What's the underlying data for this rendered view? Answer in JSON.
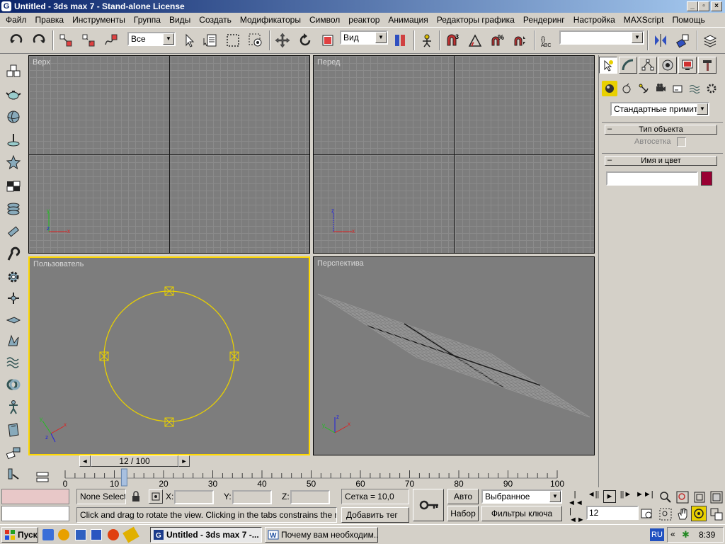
{
  "titlebar": {
    "title": "Untitled - 3ds max 7 - Stand-alone License",
    "icon": "G"
  },
  "menu": [
    "Файл",
    "Правка",
    "Инструменты",
    "Группа",
    "Виды",
    "Создать",
    "Модификаторы",
    "Символ",
    "реактор",
    "Анимация",
    "Редакторы графика",
    "Рендеринг",
    "Настройка",
    "MAXScript",
    "Помощь"
  ],
  "toolbar": {
    "selection_filter": "Все",
    "reference_coord": "Вид",
    "named_selection": ""
  },
  "viewports": {
    "top": "Верх",
    "front": "Перед",
    "user": "Пользователь",
    "perspective": "Перспектива"
  },
  "panel": {
    "category_dropdown": "Стандартные примитив",
    "rollout_object_type": "Тип объекта",
    "autogrid_label": "Автосетка",
    "rollout_name_color": "Имя и цвет",
    "object_name": "",
    "object_color": "#990033"
  },
  "timeline": {
    "slider_label": "12 / 100",
    "ticks": [
      "0",
      "10",
      "20",
      "30",
      "40",
      "50",
      "60",
      "70",
      "80",
      "90",
      "100"
    ]
  },
  "status": {
    "selection": "None Selecte",
    "x_label": "X:",
    "y_label": "Y:",
    "z_label": "Z:",
    "x_value": "",
    "y_value": "",
    "z_value": "",
    "grid": "Сетка = 10,0",
    "prompt": "Click and drag to rotate the view.  Clicking in the tabs constrains the rotation",
    "add_tag": "Добавить тег",
    "auto_key": "Авто",
    "set_key": "Набор",
    "key_mode": "Выбранное",
    "key_filters": "Фильтры ключа",
    "current_frame": "12"
  },
  "taskbar": {
    "start": "Пуск",
    "tasks": [
      "Untitled - 3ds max 7 -...",
      "Почему вам необходим..."
    ],
    "lang": "RU",
    "clock": "8:39"
  }
}
